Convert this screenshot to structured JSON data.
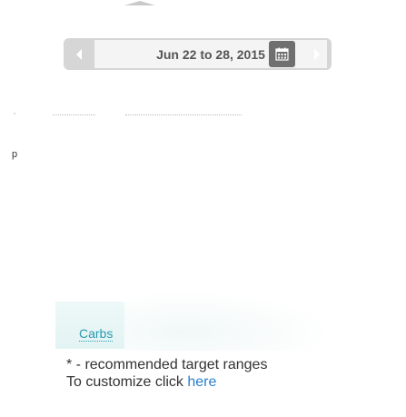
{
  "date_nav": {
    "range_label": "Jun 22 to 28, 2015",
    "prev_icon": "chevron-left-icon",
    "next_icon": "chevron-right-icon",
    "calendar_icon": "calendar-icon"
  },
  "stray_text": "p",
  "nutrient": {
    "label": "Carbs"
  },
  "footnote": {
    "line1": "* - recommended target ranges",
    "line2_prefix": "To customize click ",
    "link_text": "here"
  },
  "colors": {
    "nav_bg": "#d6d6d6",
    "calendar_btn": "#6f6f6f",
    "link_teal": "#2a9bb0",
    "link_blue": "#2a7fc9"
  }
}
